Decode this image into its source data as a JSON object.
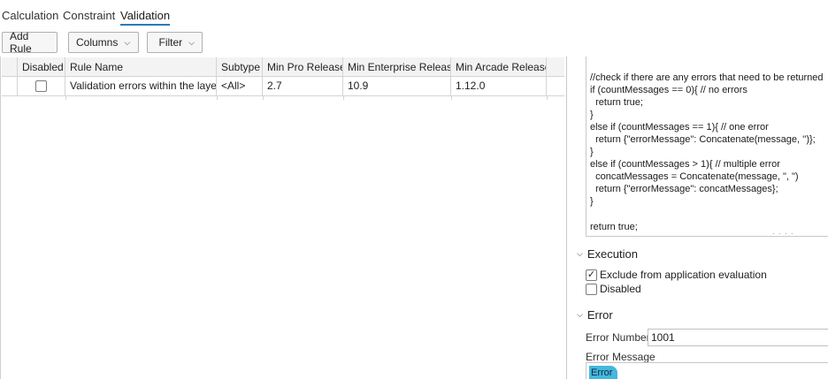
{
  "tabs": [
    {
      "label": "Calculation"
    },
    {
      "label": "Constraint"
    },
    {
      "label": "Validation"
    }
  ],
  "toolbar": {
    "add_rule": "Add Rule",
    "columns": "Columns",
    "filter": "Filter"
  },
  "grid": {
    "columns": [
      "Disabled",
      "Rule Name",
      "Subtype",
      "Min Pro Release",
      "Min Enterprise Release",
      "Min Arcade Release"
    ],
    "rows": [
      {
        "disabled": false,
        "rule_name": "Validation errors within the layer",
        "subtype": "<All>",
        "min_pro": "2.7",
        "min_enterprise": "10.9",
        "min_arcade": "1.12.0"
      }
    ]
  },
  "script": {
    "lines": [
      "",
      "//check if there are any errors that need to be returned",
      "if (countMessages == 0){ // no errors",
      "  return true;",
      "}",
      "else if (countMessages == 1){ // one error",
      "  return {\"errorMessage\": Concatenate(message, '')};",
      "}",
      "else if (countMessages > 1){ // multiple error",
      "  concatMessages = Concatenate(message, \", \")",
      "  return {\"errorMessage\": concatMessages};",
      "}",
      "",
      "return true;"
    ]
  },
  "execution": {
    "title": "Execution",
    "exclude_label": "Exclude from application evaluation",
    "exclude_checked": true,
    "disabled_label": "Disabled",
    "disabled_checked": false
  },
  "error": {
    "title": "Error",
    "number_label": "Error Number",
    "number_value": "1001",
    "message_label": "Error Message",
    "message_value": "Error"
  },
  "colors": {
    "accent": "#2a7ab8",
    "highlight": "#45b7dd"
  }
}
